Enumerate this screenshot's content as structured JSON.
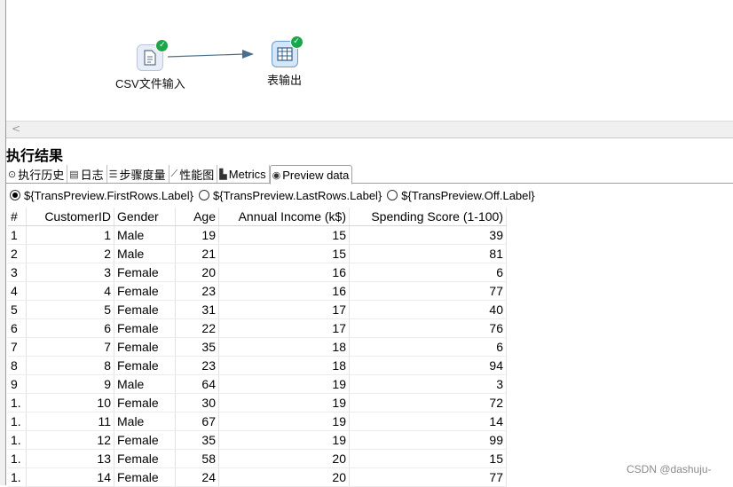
{
  "canvas": {
    "steps": [
      {
        "label": "CSV文件输入",
        "icon": "csv-file-icon",
        "status": "ok"
      },
      {
        "label": "表输出",
        "icon": "table-output-icon",
        "status": "ok"
      }
    ]
  },
  "scroll": {
    "left_arrow": "<"
  },
  "results": {
    "title": "执行结果",
    "tabs": [
      {
        "label": "执行历史",
        "icon": "history-icon"
      },
      {
        "label": "日志",
        "icon": "log-icon"
      },
      {
        "label": "步骤度量",
        "icon": "step-metrics-icon"
      },
      {
        "label": "性能图",
        "icon": "performance-chart-icon"
      },
      {
        "label": "Metrics",
        "icon": "metrics-icon"
      },
      {
        "label": "Preview data",
        "icon": "eye-icon",
        "active": true
      }
    ],
    "radio_options": [
      {
        "label": "${TransPreview.FirstRows.Label}",
        "checked": true
      },
      {
        "label": "${TransPreview.LastRows.Label}",
        "checked": false
      },
      {
        "label": "${TransPreview.Off.Label}",
        "checked": false
      }
    ],
    "table": {
      "columns": [
        "#",
        "CustomerID",
        "Gender",
        "Age",
        "Annual Income (k$)",
        "Spending Score (1-100)"
      ],
      "rows": [
        [
          "1",
          "1",
          "Male",
          "19",
          "15",
          "39"
        ],
        [
          "2",
          "2",
          "Male",
          "21",
          "15",
          "81"
        ],
        [
          "3",
          "3",
          "Female",
          "20",
          "16",
          "6"
        ],
        [
          "4",
          "4",
          "Female",
          "23",
          "16",
          "77"
        ],
        [
          "5",
          "5",
          "Female",
          "31",
          "17",
          "40"
        ],
        [
          "6",
          "6",
          "Female",
          "22",
          "17",
          "76"
        ],
        [
          "7",
          "7",
          "Female",
          "35",
          "18",
          "6"
        ],
        [
          "8",
          "8",
          "Female",
          "23",
          "18",
          "94"
        ],
        [
          "9",
          "9",
          "Male",
          "64",
          "19",
          "3"
        ],
        [
          "1.",
          "10",
          "Female",
          "30",
          "19",
          "72"
        ],
        [
          "1.",
          "11",
          "Male",
          "67",
          "19",
          "14"
        ],
        [
          "1.",
          "12",
          "Female",
          "35",
          "19",
          "99"
        ],
        [
          "1.",
          "13",
          "Female",
          "58",
          "20",
          "15"
        ],
        [
          "1.",
          "14",
          "Female",
          "24",
          "20",
          "77"
        ]
      ]
    }
  },
  "watermark": "CSDN @dashuju-"
}
